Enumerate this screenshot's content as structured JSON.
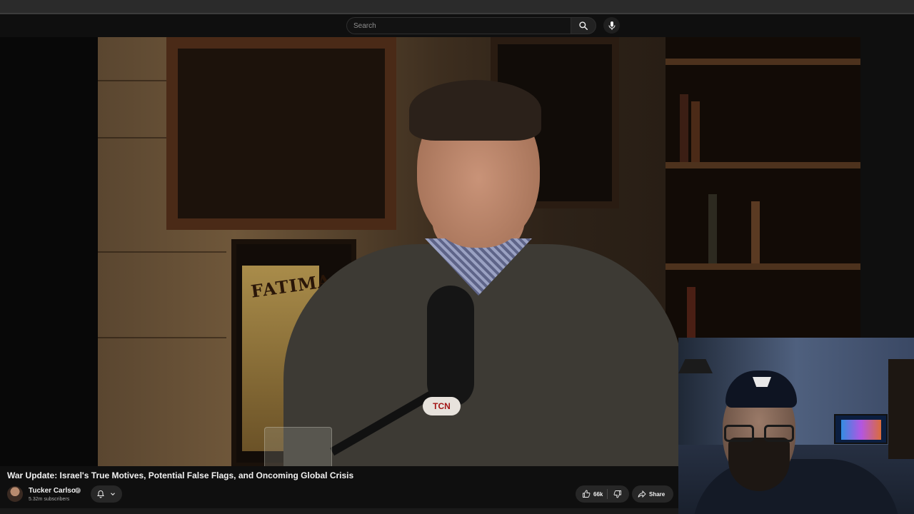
{
  "masthead": {
    "search_placeholder": "Search",
    "search_icon": "search-icon",
    "mic_icon": "mic-icon"
  },
  "player": {
    "poster_text": "FATIMA",
    "mic_badge": "TCN"
  },
  "video": {
    "title": "War Update: Israel's True Motives, Potential False Flags, and Oncoming Global Crisis"
  },
  "channel": {
    "name": "Tucker Carlson",
    "subscribers": "5.32m subscribers",
    "verified_icon": "verified-check-icon",
    "bell_icon": "bell-icon",
    "chevron_icon": "chevron-down-icon"
  },
  "actions": {
    "like_count": "66k",
    "like_icon": "thumbs-up-icon",
    "dislike_icon": "thumbs-down-icon",
    "share_label": "Share",
    "share_icon": "share-arrow-icon"
  },
  "colors": {
    "background": "#0f0f0f",
    "pill": "#272727",
    "text": "#f1f1f1",
    "secondary_text": "#aaaaaa",
    "badge_red": "#a21414"
  }
}
